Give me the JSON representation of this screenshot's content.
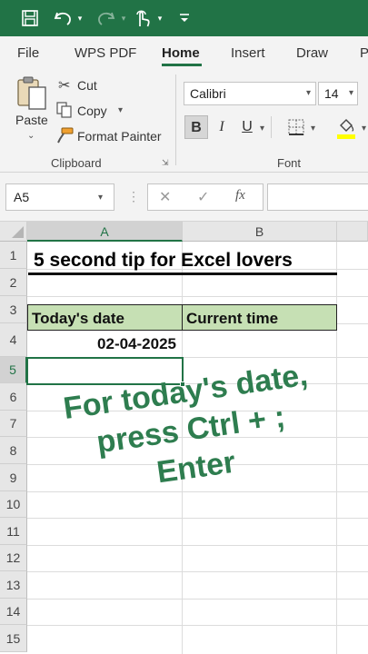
{
  "colors": {
    "accent": "#217346",
    "header_fill": "#c6e0b4",
    "overlay_text": "#2e7d4f"
  },
  "quick_access": {
    "icons": [
      "save-icon",
      "undo-icon",
      "redo-icon",
      "touch-mode-icon",
      "customize-toolbar-icon"
    ]
  },
  "tabs": [
    "File",
    "WPS PDF",
    "Home",
    "Insert",
    "Draw",
    "P"
  ],
  "active_tab": "Home",
  "clipboard": {
    "paste": "Paste",
    "cut": "Cut",
    "copy": "Copy",
    "format_painter": "Format Painter",
    "label": "Clipboard"
  },
  "font": {
    "name": "Calibri",
    "size": "14",
    "bold": "B",
    "italic": "I",
    "underline": "U",
    "label": "Font"
  },
  "formula_bar": {
    "name_box": "A5",
    "fx": "fx",
    "value": ""
  },
  "columns": [
    "A",
    "B"
  ],
  "rows": [
    "1",
    "2",
    "3",
    "4",
    "5",
    "6",
    "7",
    "8",
    "9",
    "10",
    "11",
    "12",
    "13",
    "14",
    "15"
  ],
  "selected_cell": {
    "column": "A",
    "row": "5"
  },
  "cells": {
    "A1": "5 second tip for Excel lovers",
    "A3": "Today's date",
    "B3": "Current time",
    "A4": "02-04-2025"
  },
  "overlay_lines": [
    "For today's date,",
    "press Ctrl + ;",
    "Enter"
  ]
}
